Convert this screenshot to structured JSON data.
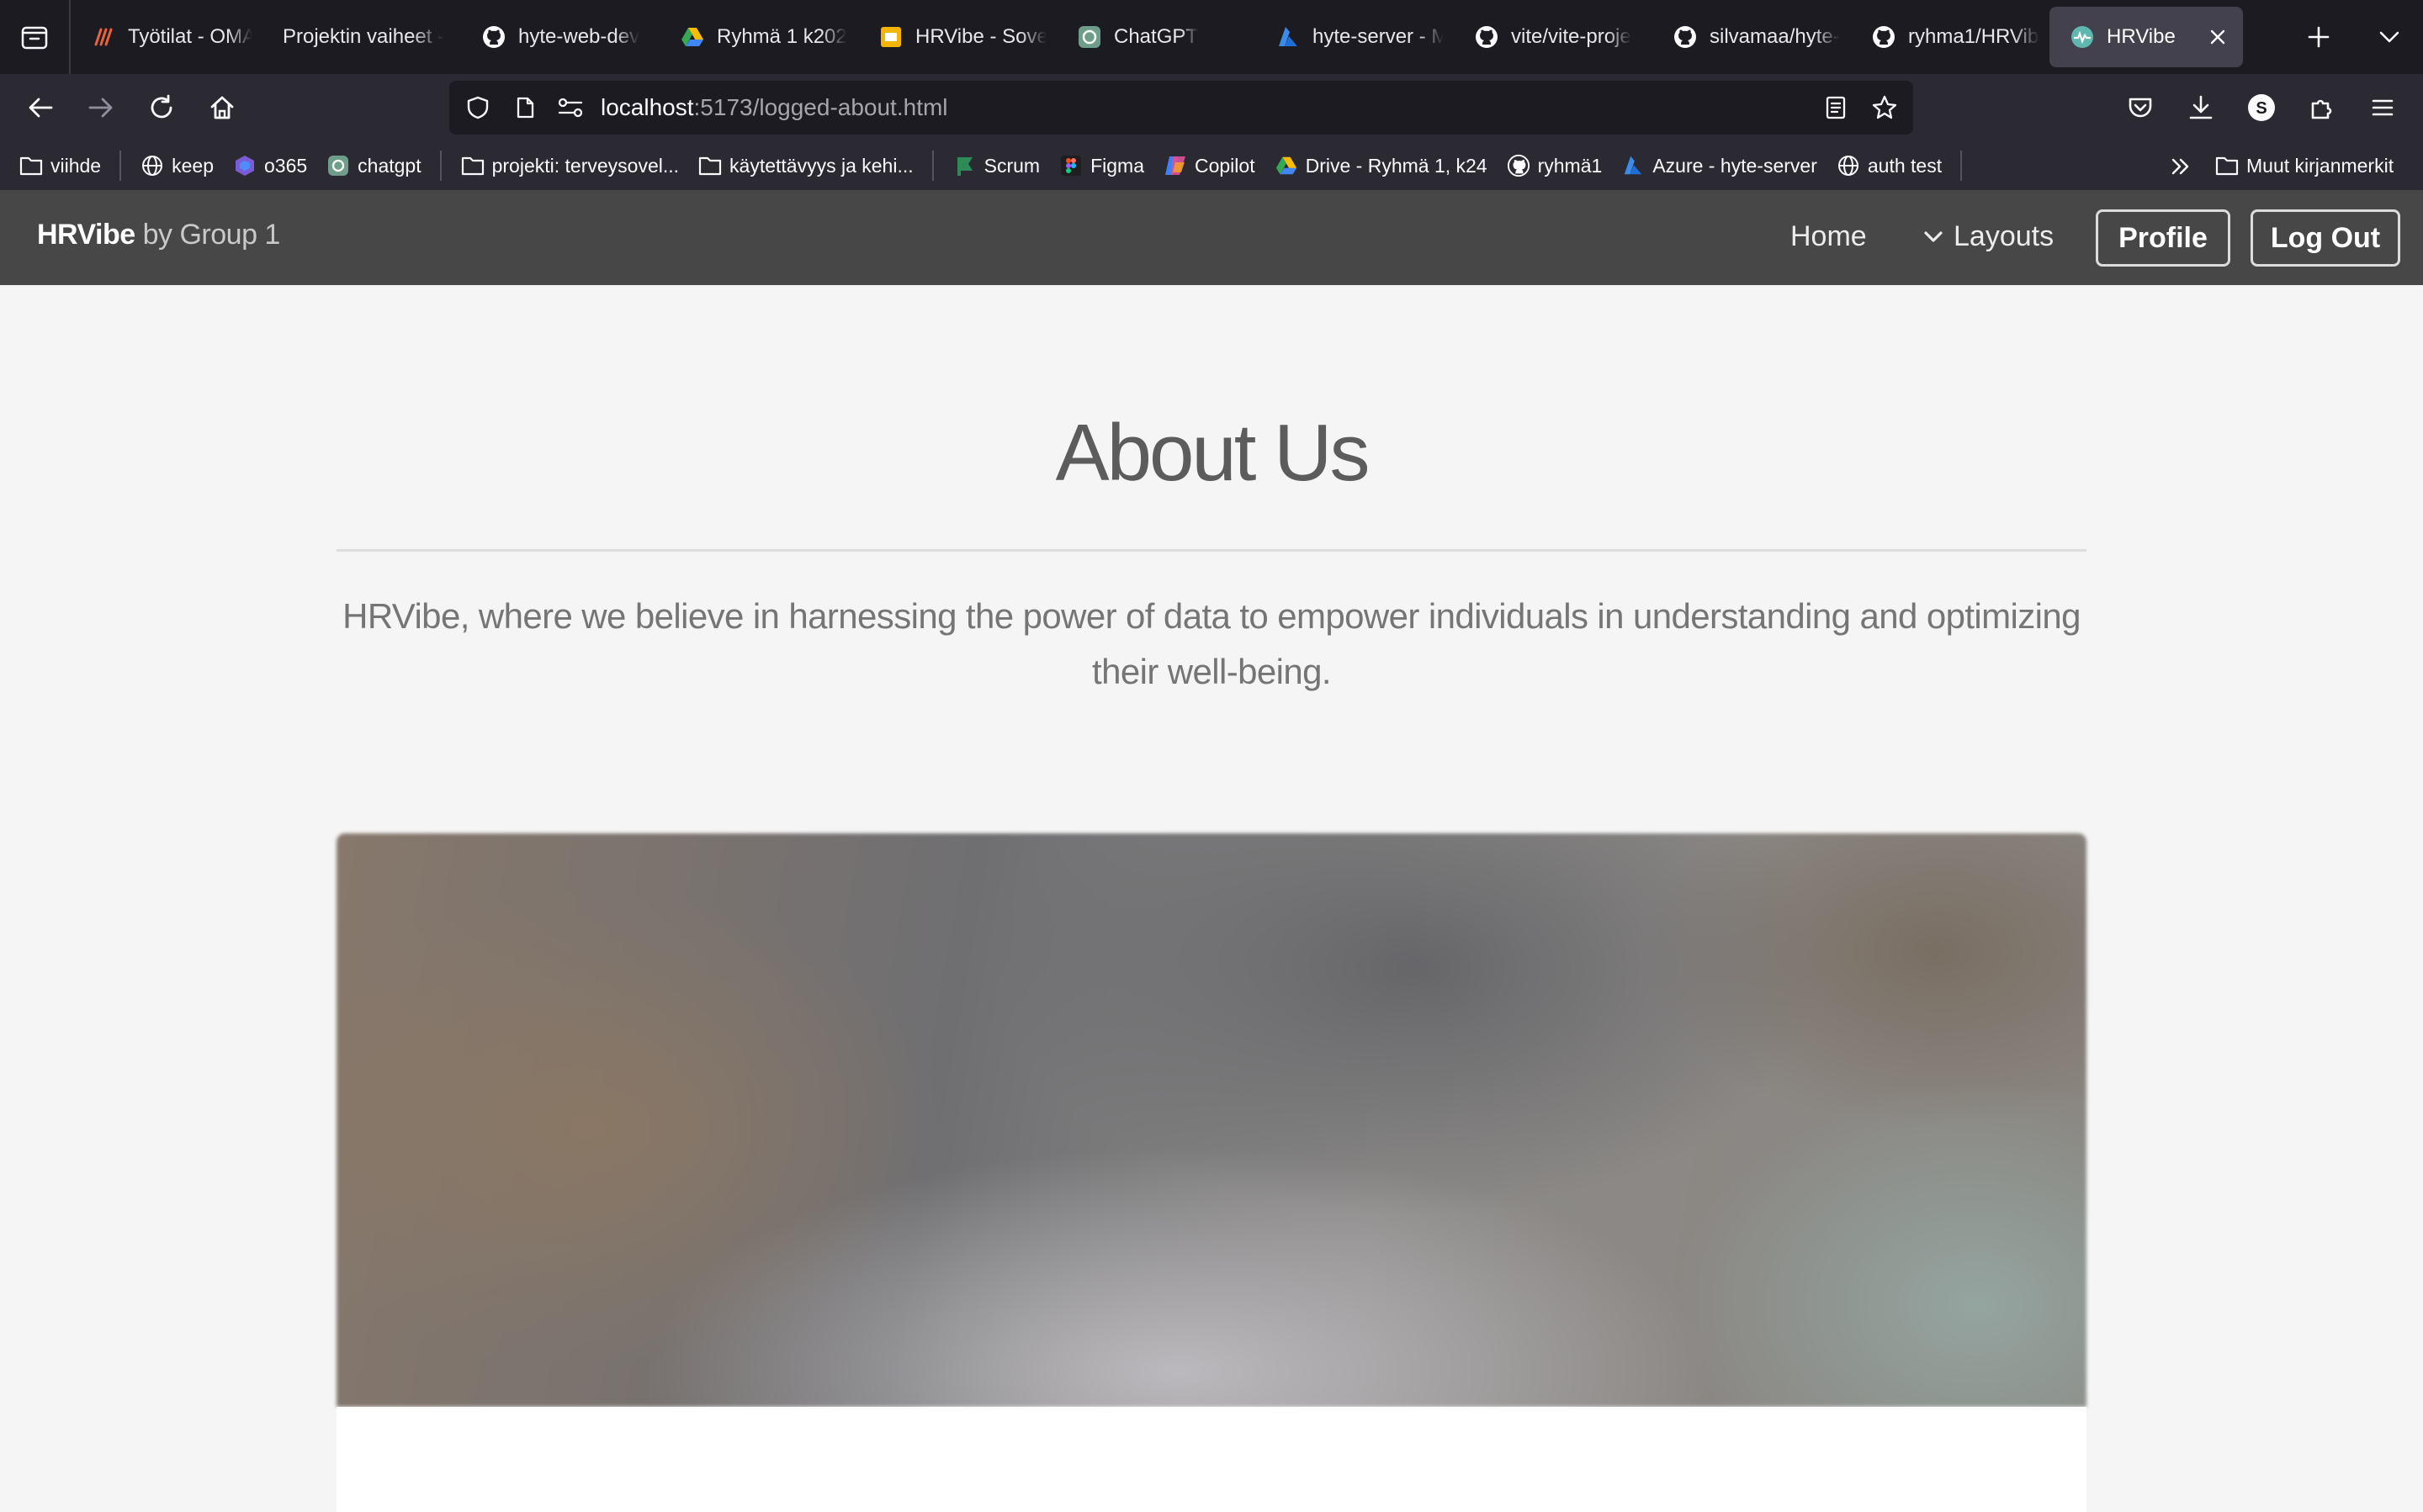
{
  "browser": {
    "tabs": [
      {
        "label": "Työtilat - OMA",
        "favicon": "oma-icon"
      },
      {
        "label": "Projektin vaiheet -",
        "favicon": "none"
      },
      {
        "label": "hyte-web-dev",
        "favicon": "github-icon"
      },
      {
        "label": "Ryhmä 1 k202",
        "favicon": "google-drive-icon"
      },
      {
        "label": "HRVibe - Sove",
        "favicon": "slides-icon"
      },
      {
        "label": "ChatGPT",
        "favicon": "chatgpt-icon"
      },
      {
        "label": "hyte-server - M",
        "favicon": "azure-icon"
      },
      {
        "label": "vite/vite-proje",
        "favicon": "github-icon"
      },
      {
        "label": "silvamaa/hyte-",
        "favicon": "github-icon"
      },
      {
        "label": "ryhma1/HRVibe",
        "favicon": "github-icon"
      },
      {
        "label": "HRVibe",
        "favicon": "hrvibe-icon",
        "active": true
      }
    ],
    "url": {
      "host": "localhost",
      "rest": ":5173/logged-about.html"
    },
    "bookmarks": [
      {
        "label": "viihde",
        "icon": "folder-icon"
      },
      {
        "label": "keep",
        "icon": "globe-icon"
      },
      {
        "label": "o365",
        "icon": "o365-icon"
      },
      {
        "label": "chatgpt",
        "icon": "chatgpt-icon"
      },
      {
        "label": "projekti: terveysovel...",
        "icon": "folder-icon"
      },
      {
        "label": "käytettävyys ja kehi...",
        "icon": "folder-icon"
      },
      {
        "label": "Scrum",
        "icon": "scrum-icon"
      },
      {
        "label": "Figma",
        "icon": "figma-icon"
      },
      {
        "label": "Copilot",
        "icon": "copilot-icon"
      },
      {
        "label": "Drive - Ryhmä 1, k24",
        "icon": "google-drive-icon"
      },
      {
        "label": "ryhmä1",
        "icon": "github-icon"
      },
      {
        "label": "Azure - hyte-server",
        "icon": "azure-icon"
      },
      {
        "label": "auth test",
        "icon": "globe-icon"
      }
    ],
    "other_bookmarks": "Muut kirjanmerkit",
    "profile_initial": "S"
  },
  "site": {
    "brand_main": "HRVibe",
    "brand_sub": " by Group 1",
    "nav": {
      "home": "Home",
      "layouts": "Layouts",
      "profile": "Profile",
      "logout": "Log Out"
    },
    "about": {
      "title": "About Us",
      "lead": "HRVibe, where we believe in harnessing the power of data to empower individuals in understanding and optimizing their well-being."
    }
  },
  "colors": {
    "tabbar": "#1c1b22",
    "toolbar": "#2b2a33",
    "site_nav": "#474747",
    "page_bg": "#f5f5f5"
  }
}
